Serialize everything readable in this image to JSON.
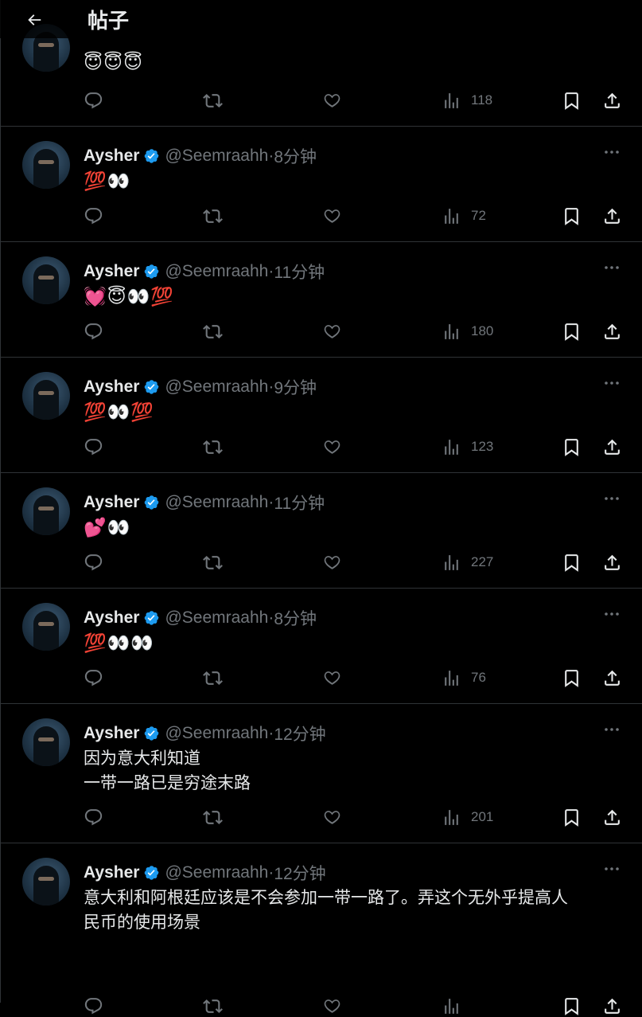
{
  "header": {
    "title": "帖子"
  },
  "posts": [
    {
      "name": "",
      "handle": "",
      "time": "",
      "text": "😇😇😇",
      "views": "118"
    },
    {
      "name": "Aysher",
      "handle": "@Seemraahh",
      "time": "8分钟",
      "text": "💯👀",
      "views": "72"
    },
    {
      "name": "Aysher",
      "handle": "@Seemraahh",
      "time": "11分钟",
      "text": "💓😇👀💯",
      "views": "180"
    },
    {
      "name": "Aysher",
      "handle": "@Seemraahh",
      "time": "9分钟",
      "text": "💯👀💯",
      "views": "123"
    },
    {
      "name": "Aysher",
      "handle": "@Seemraahh",
      "time": "11分钟",
      "text": "💕👀",
      "views": "227"
    },
    {
      "name": "Aysher",
      "handle": "@Seemraahh",
      "time": "8分钟",
      "text": "💯👀👀",
      "views": "76"
    },
    {
      "name": "Aysher",
      "handle": "@Seemraahh",
      "time": "12分钟",
      "text": "因为意大利知道\n一带一路已是穷途末路",
      "views": "201"
    },
    {
      "name": "Aysher",
      "handle": "@Seemraahh",
      "time": "12分钟",
      "text": "意大利和阿根廷应该是不会参加一带一路了。弄这个无外乎提高人\n民币的使用场景",
      "views": ""
    }
  ],
  "separator": " · ",
  "colors": {
    "background": "#000000",
    "verified": "#1d9bf0",
    "muted": "#71767b",
    "text": "#e7e9ea",
    "divider": "#2f3336"
  },
  "icons": [
    "back-arrow-icon",
    "verified-badge-icon",
    "more-icon",
    "reply-icon",
    "retweet-icon",
    "like-icon",
    "views-icon",
    "bookmark-icon",
    "share-icon"
  ]
}
